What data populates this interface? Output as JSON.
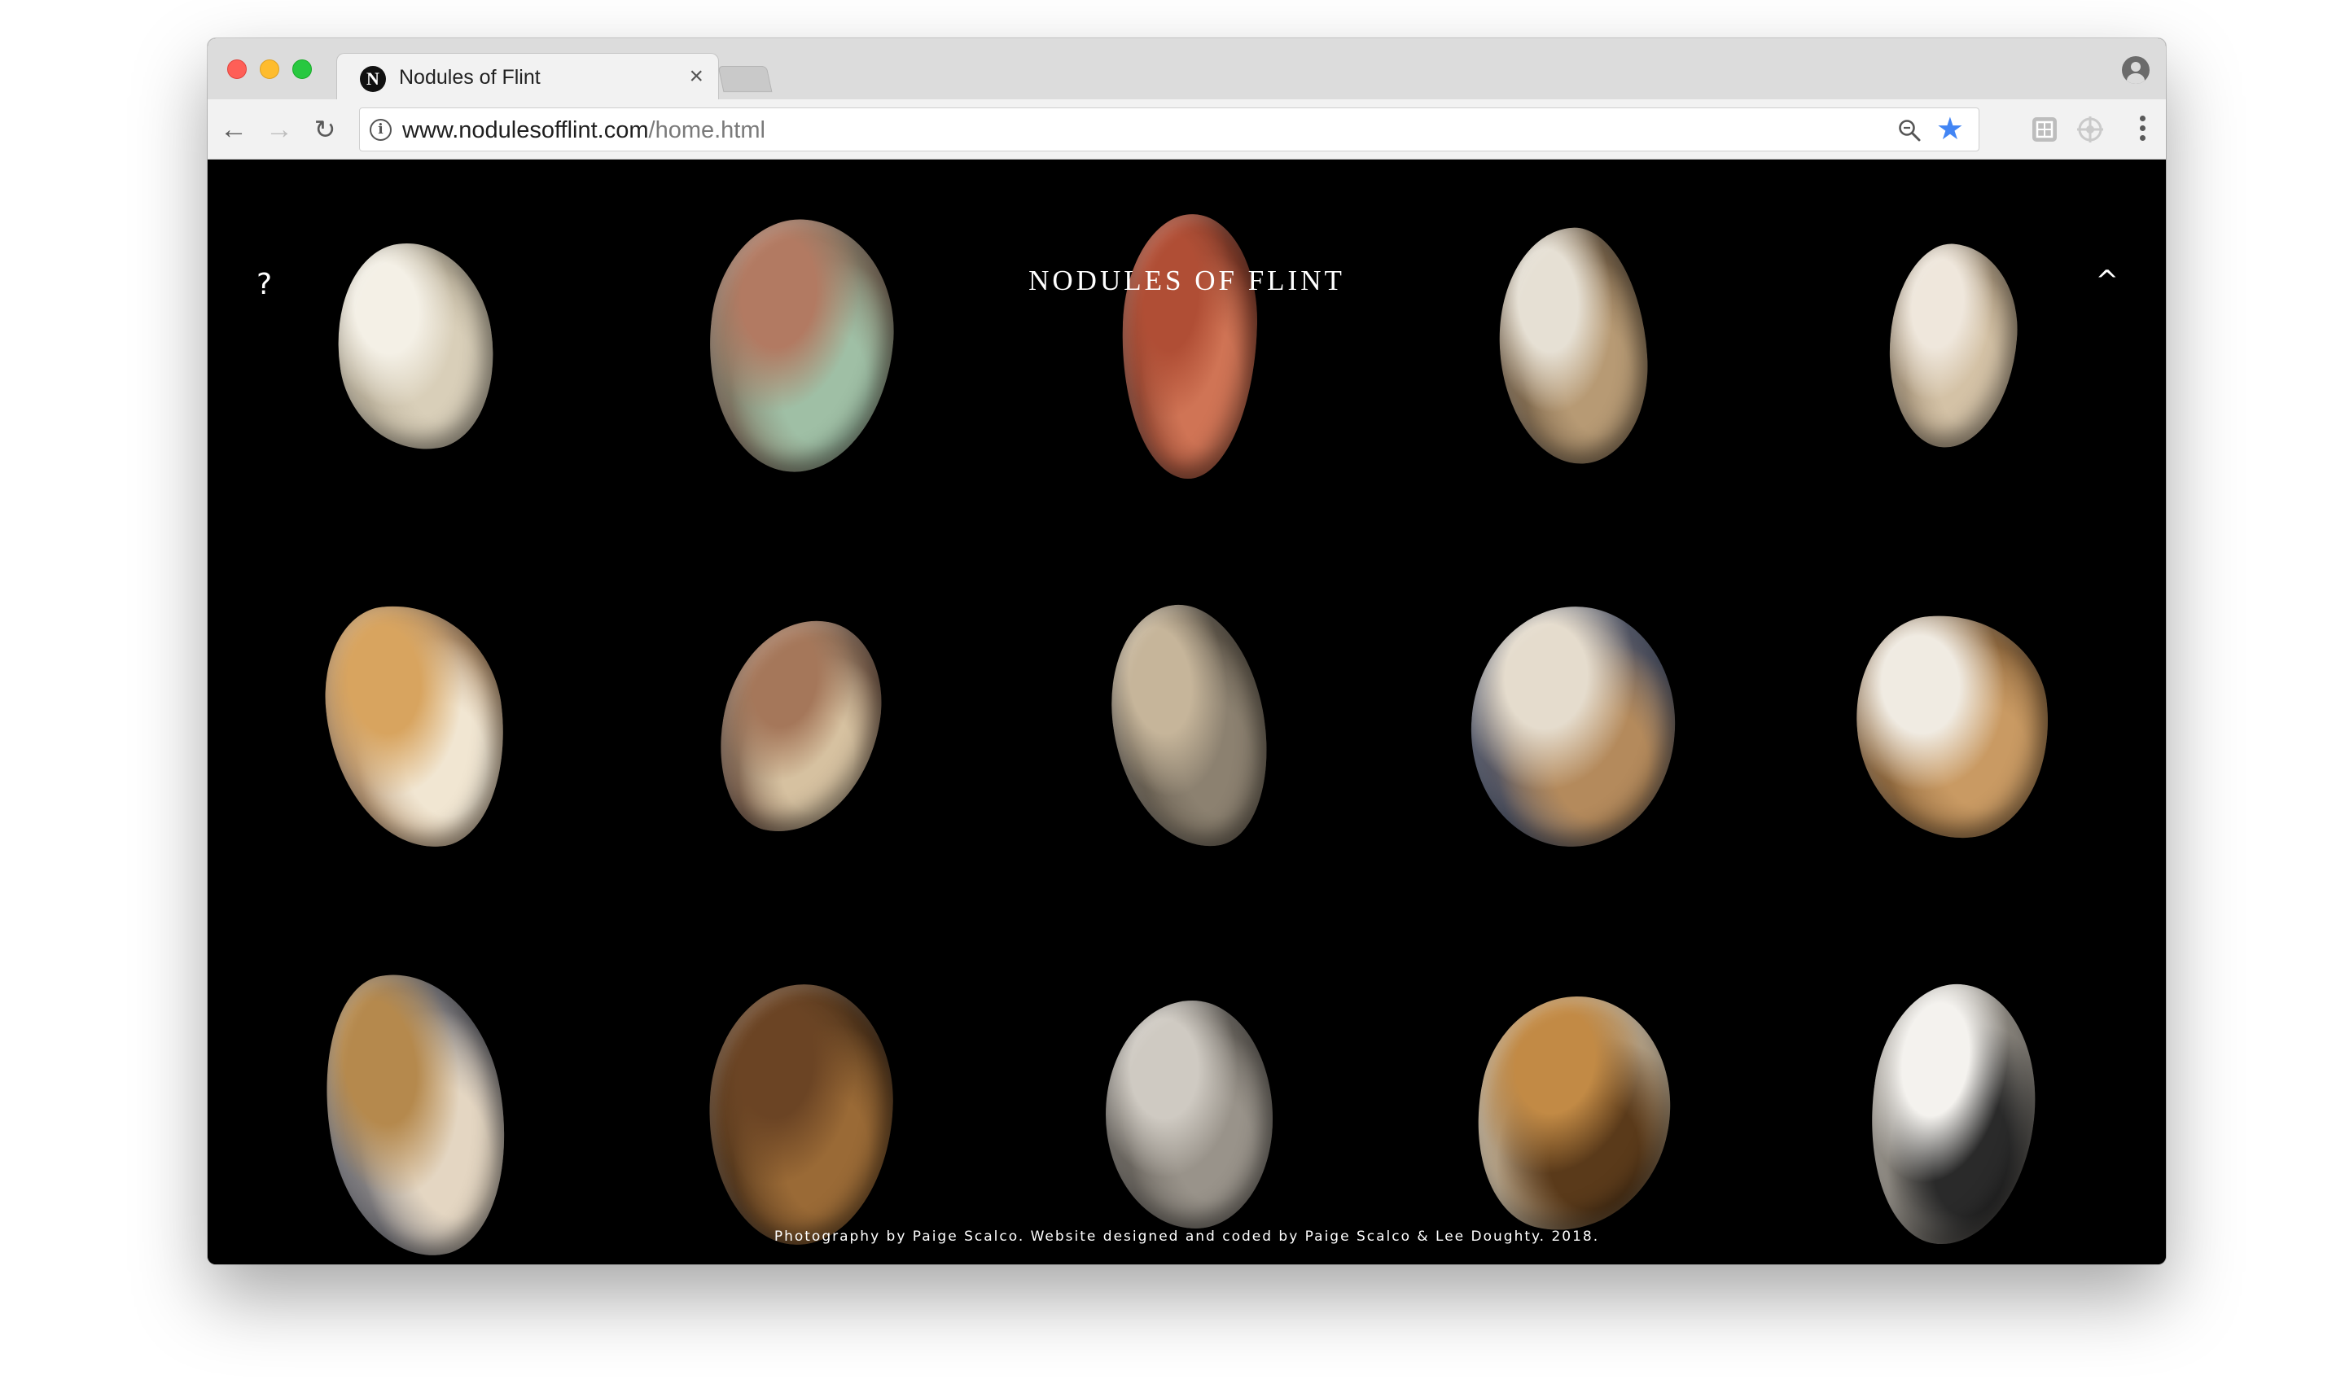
{
  "browser": {
    "tab_title": "Nodules of Flint",
    "tab_favicon_letter": "N",
    "tab_close": "×",
    "url_host": "www.nodulesofflint.com",
    "url_path": "/home.html",
    "icons": {
      "back": "back-arrow-icon",
      "forward": "forward-arrow-icon",
      "reload": "reload-icon",
      "info": "info-icon",
      "zoom": "zoom-icon",
      "bookmark": "star-icon",
      "extensions": [
        "extension-icon",
        "extension-icon"
      ],
      "menu": "menu-icon",
      "profile": "profile-icon"
    },
    "bookmark_color": "#4285f4"
  },
  "page": {
    "title": "NODULES OF FLINT",
    "help": "?",
    "up": "^",
    "credit": "Photography by Paige Scalco. Website designed and coded by Paige Scalco & Lee Doughty. 2018.",
    "background": "#000000",
    "stones": [
      {
        "name": "flint-1",
        "colors": [
          "#f4f0e6",
          "#d9cfb9",
          "#a99f8a"
        ]
      },
      {
        "name": "flint-2",
        "colors": [
          "#b27a62",
          "#9fbfa5",
          "#6e4b3c"
        ]
      },
      {
        "name": "flint-3",
        "colors": [
          "#b04e35",
          "#d07455",
          "#5e2115"
        ]
      },
      {
        "name": "flint-4",
        "colors": [
          "#e6e0d4",
          "#b79a74",
          "#5c4a36"
        ]
      },
      {
        "name": "flint-5",
        "colors": [
          "#efe7dc",
          "#d4c2a6",
          "#8c7a62"
        ]
      },
      {
        "name": "flint-6",
        "colors": [
          "#d8a45f",
          "#f1e6d2",
          "#8a5a2c"
        ]
      },
      {
        "name": "flint-7",
        "colors": [
          "#a5775a",
          "#d6c1a0",
          "#55372a"
        ]
      },
      {
        "name": "flint-8",
        "colors": [
          "#c6b59a",
          "#8c8170",
          "#4f473c"
        ]
      },
      {
        "name": "flint-9",
        "colors": [
          "#e5dccd",
          "#b48a5c",
          "#203b6b"
        ]
      },
      {
        "name": "flint-10",
        "colors": [
          "#f0ebe2",
          "#c99a63",
          "#6b4a28"
        ]
      },
      {
        "name": "flint-11",
        "colors": [
          "#b5894d",
          "#e4d6c2",
          "#3c4152"
        ]
      },
      {
        "name": "flint-12",
        "colors": [
          "#6b4424",
          "#9a6a36",
          "#2c1a0e"
        ]
      },
      {
        "name": "flint-13",
        "colors": [
          "#cfcac2",
          "#99938a",
          "#4e4a45"
        ]
      },
      {
        "name": "flint-14",
        "colors": [
          "#c28a45",
          "#5a3a1a",
          "#f0e3c9"
        ]
      },
      {
        "name": "flint-15",
        "colors": [
          "#f4f2ee",
          "#2a2a2a",
          "#cfc7ba"
        ]
      }
    ]
  }
}
